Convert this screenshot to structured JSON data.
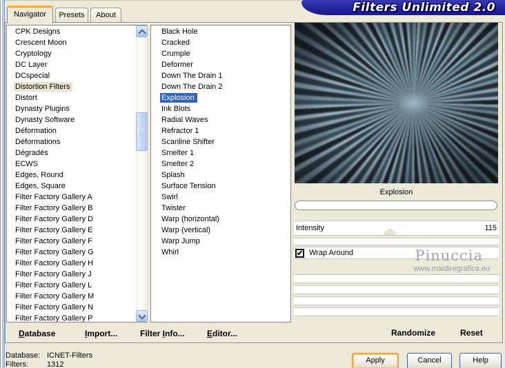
{
  "title_banner": {
    "text": "Filters Unlimited 2.0"
  },
  "tabs": [
    {
      "label": "Navigator"
    },
    {
      "label": "Presets"
    },
    {
      "label": "About"
    }
  ],
  "active_tab": "Navigator",
  "category_list": {
    "selected": "Distortion Filters",
    "items": [
      "CPK Designs",
      "Crescent Moon",
      "Cryptology",
      "DC Layer",
      "DCspecial",
      "Distortion Filters",
      "Distort",
      "Dynasty Plugins",
      "Dynasty Software",
      "Déformation",
      "Déformations",
      "Dégradés",
      "ECWS",
      "Edges, Round",
      "Edges, Square",
      "Filter Factory Gallery A",
      "Filter Factory Gallery B",
      "Filter Factory Gallery D",
      "Filter Factory Gallery E",
      "Filter Factory Gallery F",
      "Filter Factory Gallery G",
      "Filter Factory Gallery H",
      "Filter Factory Gallery J",
      "Filter Factory Gallery L",
      "Filter Factory Gallery M",
      "Filter Factory Gallery N",
      "Filter Factory Gallery P"
    ]
  },
  "filter_list": {
    "selected": "Explosion",
    "items": [
      "Black Hole",
      "Cracked",
      "Crumple",
      "Deformer",
      "Down The Drain 1",
      "Down The Drain 2",
      "Explosion",
      "Ink Blots",
      "Radial Waves",
      "Refractor 1",
      "Scanline Shifter",
      "Smelter 1",
      "Smelter 2",
      "Splash",
      "Surface Tension",
      "Swirl",
      "Twister",
      "Warp (horizontal)",
      "Warp (vertical)",
      "Warp Jump",
      "Whirl"
    ]
  },
  "preview": {
    "caption": "Explosion"
  },
  "controls": {
    "intensity": {
      "label": "Intensity",
      "value": "115"
    },
    "wrap_around": {
      "label": "Wrap Around",
      "checked": true
    }
  },
  "watermark": {
    "name": "Pinuccia",
    "site": "www.maidiregrafica.eu"
  },
  "panel_buttons": {
    "randomize": "Randomize",
    "reset": "Reset"
  },
  "menu_buttons": [
    {
      "pre": "",
      "key": "D",
      "post": "atabase"
    },
    {
      "pre": "",
      "key": "I",
      "post": "mport..."
    },
    {
      "pre": "Filter ",
      "key": "I",
      "post": "nfo..."
    },
    {
      "pre": "",
      "key": "E",
      "post": "ditor..."
    }
  ],
  "status": {
    "database_label": "Database:",
    "database_value": "ICNET-Filters",
    "filters_label": "Filters:",
    "filters_value": "1312"
  },
  "dialog_buttons": {
    "apply": "Apply",
    "cancel": "Cancel",
    "help": "Help"
  },
  "colors": {
    "banner": "#24249e",
    "selection": "#2f63c4",
    "tab-accent": "#f59a3c",
    "beige": "#ece9d8"
  }
}
